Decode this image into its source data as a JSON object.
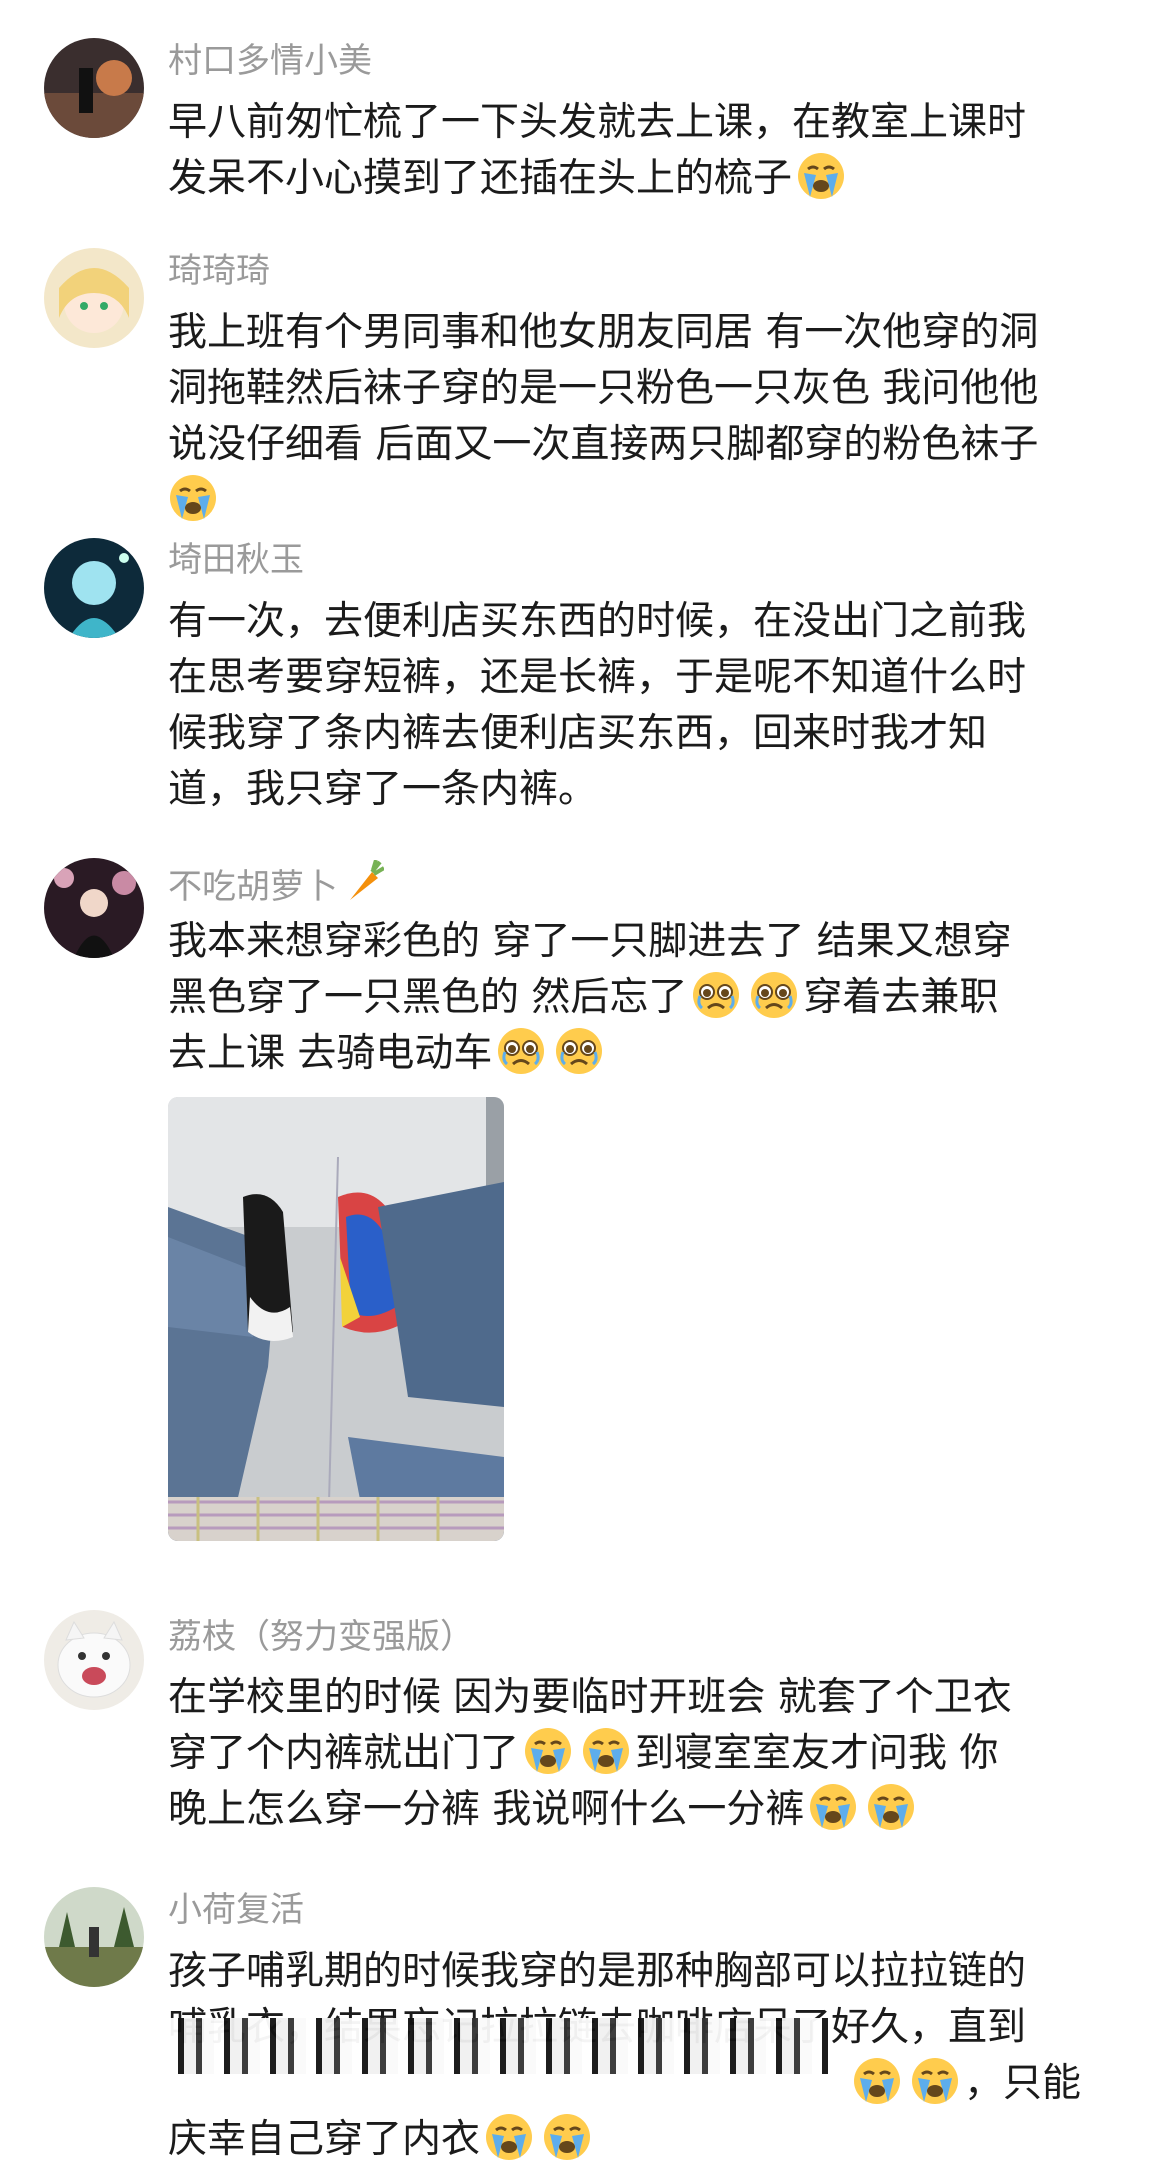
{
  "comments": [
    {
      "username": "村口多情小美",
      "lines": [
        "早八前匆忙梳了一下头发就去上课，在教室上课时",
        "发呆不小心摸到了还插在头上的梳子"
      ],
      "emoji": "loudly-crying-face"
    },
    {
      "username": "琦琦琦",
      "lines": [
        "我上班有个男同事和他女朋友同居 有一次他穿的洞",
        "洞拖鞋然后袜子穿的是一只粉色一只灰色 我问他他",
        "说没仔细看 后面又一次直接两只脚都穿的粉色袜子"
      ],
      "emoji": "loudly-crying-face"
    },
    {
      "username": "埼田秋玉",
      "lines": [
        "有一次，去便利店买东西的时候，在没出门之前我",
        "在思考要穿短裤，还是长裤，于是呢不知道什么时",
        "候我穿了条内裤去便利店买东西，回来时我才知",
        "道，我只穿了一条内裤。"
      ]
    },
    {
      "username": "不吃胡萝卜",
      "username_emoji": "carrot",
      "lines": [
        "我本来想穿彩色的 穿了一只脚进去了 结果又想穿",
        "黑色穿了一只黑色的 然后忘了",
        "穿着去兼职",
        "去上课 去骑电动车"
      ],
      "emoji": "pleading-crying-face",
      "photo": "mismatched-shoes-photo"
    },
    {
      "username": "荔枝（努力变强版）",
      "lines": [
        "在学校里的时候 因为要临时开班会 就套了个卫衣",
        "穿了个内裤就出门了",
        "到寝室室友才问我 你",
        "晚上怎么穿一分裤 我说啊什么一分裤"
      ],
      "emoji": "loudly-crying-face"
    },
    {
      "username": "小荷复活",
      "lines": [
        "孩子哺乳期的时候我穿的是那种胸部可以拉拉链的",
        "哺乳衣，结果忘记拉拉链去咖啡店呆了好久，直到",
        "，只能",
        "庆幸自己穿了内衣"
      ],
      "emoji": "loudly-crying-face"
    }
  ]
}
